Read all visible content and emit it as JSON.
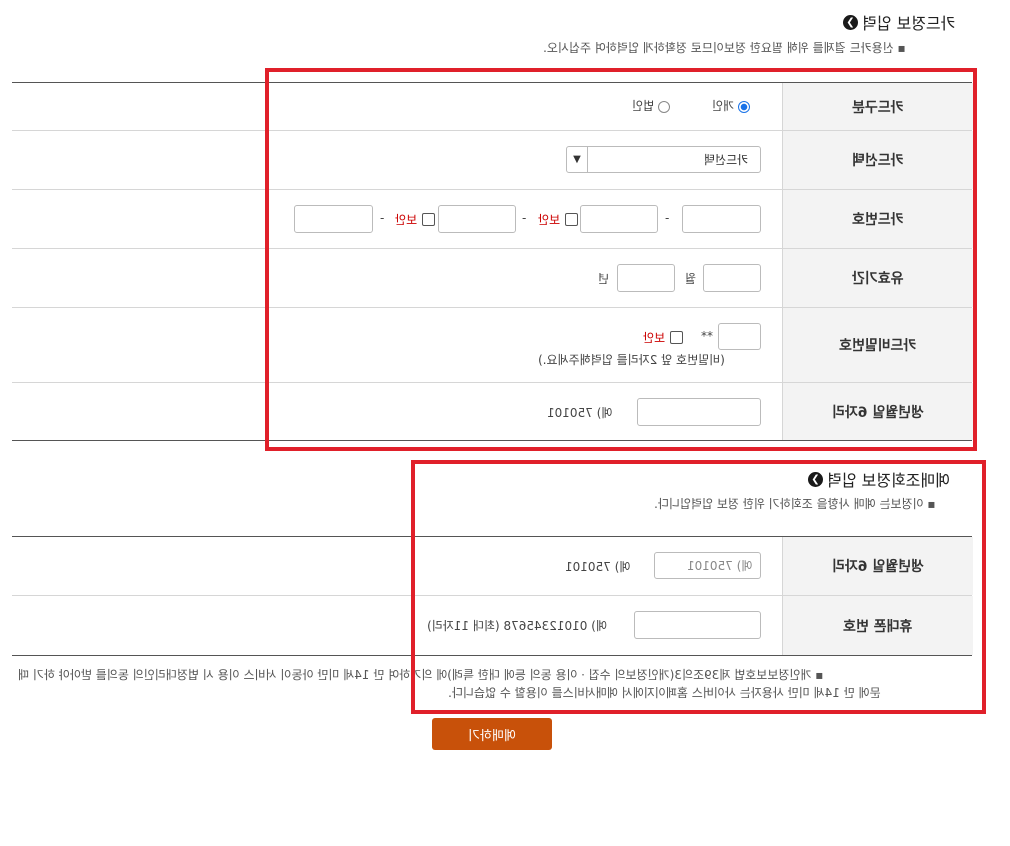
{
  "card_section": {
    "title": "카드정보 입력",
    "note": "신용카드 결제를 위해 필요한 정보이므로 정확하게 입력하여 주십시오.",
    "rows": {
      "card_type": {
        "label": "카드구분",
        "options": [
          "개인",
          "법인"
        ],
        "selected": "개인"
      },
      "card_select": {
        "label": "카드선택",
        "value": "카드선택"
      },
      "card_number": {
        "label": "카드번호",
        "dash": "-",
        "secure_label": "보안"
      },
      "expiry": {
        "label": "유효기간",
        "month_unit": "월",
        "year_unit": "년"
      },
      "password": {
        "label": "카드비밀번호",
        "mask": "**",
        "secure_label": "보안",
        "hint": "(비밀번호 앞 2자리를 입력해주세요.)"
      },
      "birth": {
        "label": "생년월일 6자리",
        "example": "예) 750101"
      }
    }
  },
  "reservation_section": {
    "title": "예매조회정보 입력",
    "note": "이정보는 예매 사항을 조회하기 위한 정보 입력입니다.",
    "rows": {
      "birth": {
        "label": "생년월일 6자리",
        "placeholder": "예) 750101",
        "example": "예) 750101"
      },
      "phone": {
        "label": "휴대폰 번호",
        "example": "예) 01012345678 (최대 11자리)"
      }
    }
  },
  "privacy_notice": {
    "line1": "개인정보보호법 제39조의3(개인정보의 수집ㆍ이용 동의 등에 대한 특례)에 의거하여 만 14세 미만 아동이 서비스 이용 시 법정대리인의 동의를 받아야 하기 때",
    "line2": "문에 만 14세 미만 사용자는 사이버스 홈페이지에서 예매서비스를 이용할 수 없습니다."
  },
  "submit": {
    "label": "예매하기"
  },
  "colors": {
    "highlight": "#e0202a",
    "button": "#c8510a",
    "radio": "#1a73e8"
  }
}
